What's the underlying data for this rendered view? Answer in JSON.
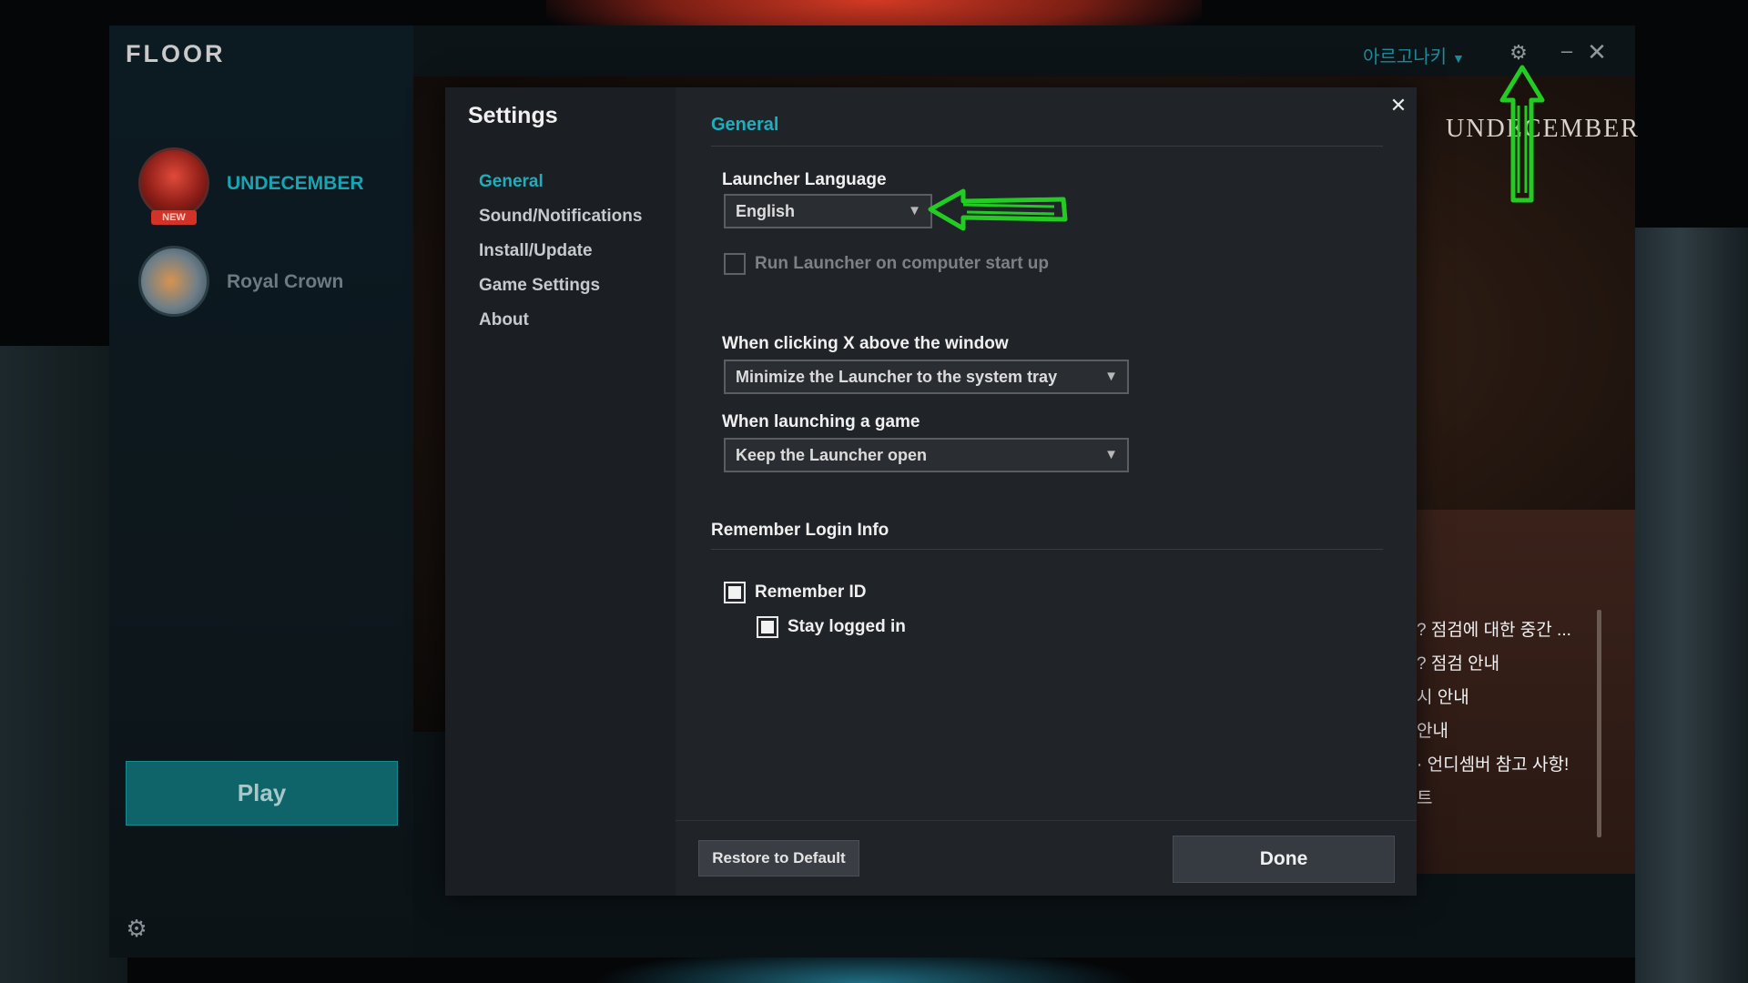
{
  "launcher": {
    "logo": "FLOOR",
    "user_name": "아르고나키",
    "game_logo": "UNDECEMBER",
    "play_label": "Play"
  },
  "games": [
    {
      "name": "UNDECEMBER",
      "badge": "NEW"
    },
    {
      "name": "Royal Crown"
    }
  ],
  "news": [
    "? 점검에 대한 중간 ...",
    "? 점검 안내",
    "시 안내",
    "안내",
    "· 언디셈버 참고 사항!",
    "트"
  ],
  "dialog": {
    "title": "Settings",
    "nav": [
      "General",
      "Sound/Notifications",
      "Install/Update",
      "Game Settings",
      "About"
    ],
    "active_nav": "General",
    "section_general": "General",
    "launcher_language": {
      "label": "Launcher Language",
      "value": "English"
    },
    "run_on_startup": {
      "label": "Run Launcher on computer start up",
      "checked": false,
      "disabled": true
    },
    "on_close": {
      "label": "When clicking X above the window",
      "value": "Minimize the Launcher to the system tray"
    },
    "on_launch": {
      "label": "When launching a game",
      "value": "Keep the Launcher open"
    },
    "section_login": "Remember Login Info",
    "remember_id": {
      "label": "Remember ID",
      "checked": true
    },
    "stay_logged_in": {
      "label": "Stay logged in",
      "checked": true
    },
    "restore_label": "Restore to Default",
    "done_label": "Done"
  },
  "icons": {
    "gear": "gear-icon",
    "close": "close-icon",
    "minimize": "minimize-icon",
    "dropdown": "caret-down-icon"
  },
  "colors": {
    "accent": "#1faebd",
    "play": "#0f6469",
    "annotation": "#22cc22"
  }
}
